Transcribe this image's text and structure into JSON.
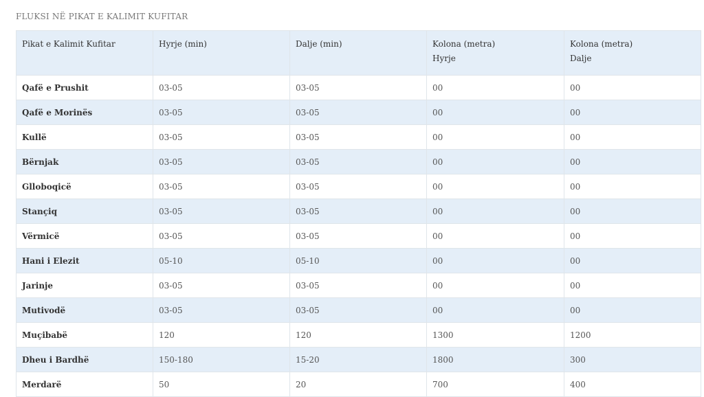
{
  "caption": "FLUKSI NË PIKAT E KALIMIT KUFITAR",
  "table": {
    "headers": [
      {
        "line1": "Pikat e Kalimit Kufitar",
        "line2": ""
      },
      {
        "line1": "Hyrje (min)",
        "line2": ""
      },
      {
        "line1": "Dalje (min)",
        "line2": ""
      },
      {
        "line1": "Kolona (metra)",
        "line2": "Hyrje"
      },
      {
        "line1": "Kolona (metra)",
        "line2": "Dalje"
      }
    ],
    "rows": [
      [
        "Qafë e Prushit",
        "03-05",
        "03-05",
        "00",
        "00"
      ],
      [
        "Qafë e Morinës",
        "03-05",
        "03-05",
        "00",
        "00"
      ],
      [
        "Kullë",
        "03-05",
        "03-05",
        "00",
        "00"
      ],
      [
        "Bërnjak",
        "03-05",
        "03-05",
        "00",
        "00"
      ],
      [
        "Glloboqicë",
        "03-05",
        "03-05",
        "00",
        "00"
      ],
      [
        "Stançiq",
        "03-05",
        "03-05",
        "00",
        "00"
      ],
      [
        "Vërmicë",
        "03-05",
        "03-05",
        "00",
        "00"
      ],
      [
        "Hani i Elezit",
        "05-10",
        "05-10",
        "00",
        "00"
      ],
      [
        "Jarinje",
        "03-05",
        "03-05",
        "00",
        "00"
      ],
      [
        "Mutivodë",
        "03-05",
        "03-05",
        "00",
        "00"
      ],
      [
        "Muçibabë",
        "120",
        "120",
        "1300",
        "1200"
      ],
      [
        "Dheu i Bardhë",
        "150-180",
        "15-20",
        "1800",
        "300"
      ],
      [
        "Merdarë",
        "50",
        "20",
        "700",
        "400"
      ]
    ]
  }
}
